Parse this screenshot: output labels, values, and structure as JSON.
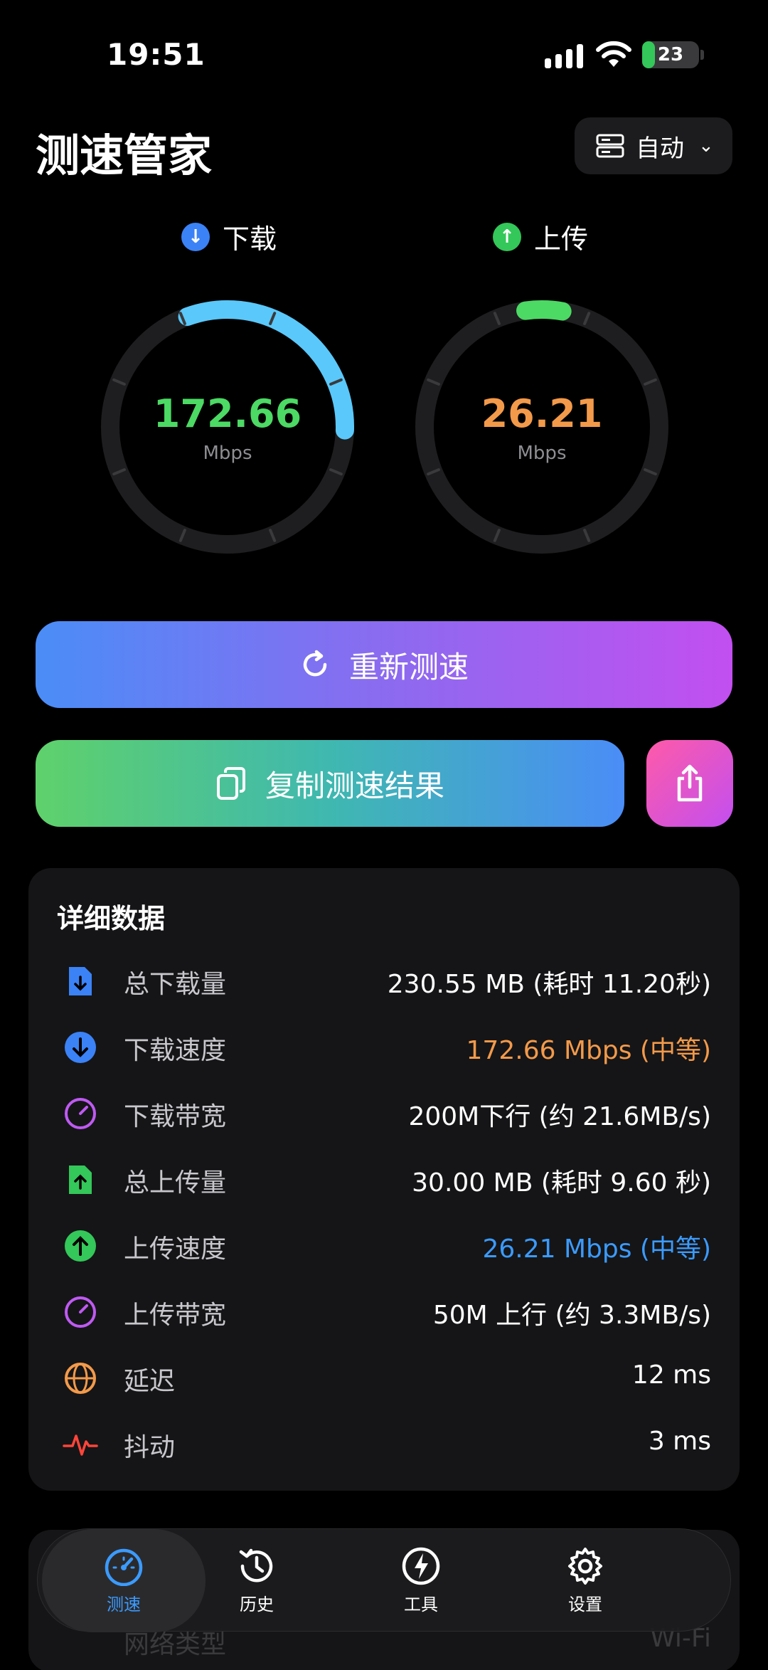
{
  "status_bar": {
    "time": "19:51",
    "battery": "23",
    "battery_level": 0.23,
    "battery_color": "#34c759"
  },
  "header": {
    "title": "测速管家",
    "mode_label": "自动",
    "mode_icon": "server-icon",
    "chevron_icon": "chevron-down-icon"
  },
  "download": {
    "label": "下载",
    "value": "172.66",
    "unit": "Mbps",
    "color": "#4cd964",
    "arc_color": "#5ac8fa",
    "dot_color": "#3b82f6",
    "fill_level": 0.31
  },
  "upload": {
    "label": "上传",
    "value": "26.21",
    "unit": "Mbps",
    "color": "#f39a4a",
    "arc_color": "#4cd964",
    "dot_color": "#34c759",
    "fill_level": 0.05
  },
  "actions": {
    "retest_label": "重新测速",
    "copy_label": "复制测速结果",
    "share_icon": "share-icon"
  },
  "details": {
    "title": "详细数据",
    "rows": [
      {
        "name": "总下载量",
        "value": "230.55 MB (耗时 11.20秒)",
        "icon": "file-download-icon",
        "value_color": "#ffffff"
      },
      {
        "name": "下载速度",
        "value": "172.66 Mbps (中等)",
        "icon": "arrow-down-circle-icon",
        "value_color": "#f39a4a"
      },
      {
        "name": "下载带宽",
        "value": "200M下行 (约 21.6MB/s)",
        "icon": "gauge-icon",
        "value_color": "#ffffff"
      },
      {
        "name": "总上传量",
        "value": "30.00 MB (耗时 9.60 秒)",
        "icon": "file-upload-icon",
        "value_color": "#ffffff"
      },
      {
        "name": "上传速度",
        "value": "26.21 Mbps (中等)",
        "icon": "arrow-up-circle-icon",
        "value_color": "#3b9bff"
      },
      {
        "name": "上传带宽",
        "value": "50M 上行 (约 3.3MB/s)",
        "icon": "gauge-icon",
        "value_color": "#ffffff"
      },
      {
        "name": "延迟",
        "value": "12 ms",
        "icon": "globe-icon",
        "value_color": "#ffffff"
      },
      {
        "name": "抖动",
        "value": "3 ms",
        "icon": "pulse-icon",
        "value_color": "#ffffff"
      }
    ],
    "hidden_row": {
      "name": "网络类型",
      "value": "Wi-Fi"
    }
  },
  "tabs": [
    {
      "label": "测速",
      "icon": "speedometer-icon",
      "active": true
    },
    {
      "label": "历史",
      "icon": "history-icon",
      "active": false
    },
    {
      "label": "工具",
      "icon": "lightning-icon",
      "active": false
    },
    {
      "label": "设置",
      "icon": "gear-icon",
      "active": false
    }
  ],
  "accent": "#3b9bff"
}
